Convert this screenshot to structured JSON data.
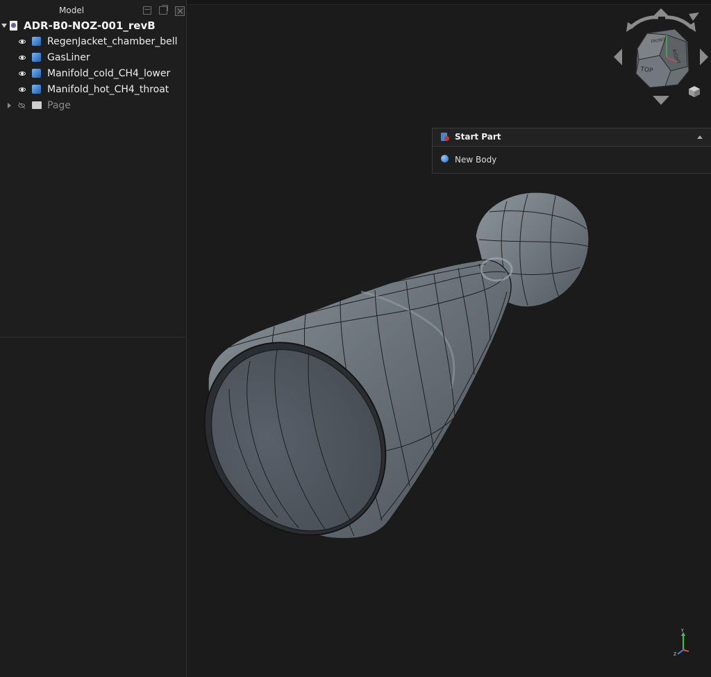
{
  "model_panel": {
    "title": "Model",
    "root": {
      "label": "ADR-B0-NOZ-001_revB"
    },
    "bodies": [
      {
        "label": "RegenJacket_chamber_bell"
      },
      {
        "label": "GasLiner"
      },
      {
        "label": "Manifold_cold_CH4_lower"
      },
      {
        "label": "Manifold_hot_CH4_throat"
      }
    ],
    "page": {
      "label": "Page"
    }
  },
  "start_part": {
    "title": "Start Part",
    "items": [
      {
        "label": "New Body"
      }
    ]
  },
  "navcube": {
    "faces": [
      "TOP",
      "FRONT",
      "RIGHT"
    ]
  },
  "axis_triad": {
    "labels": [
      "Y",
      "Z"
    ]
  },
  "colors": {
    "background": "#1b1b1b",
    "model_surface": "#6a727a",
    "accent": "#3f86d6"
  }
}
